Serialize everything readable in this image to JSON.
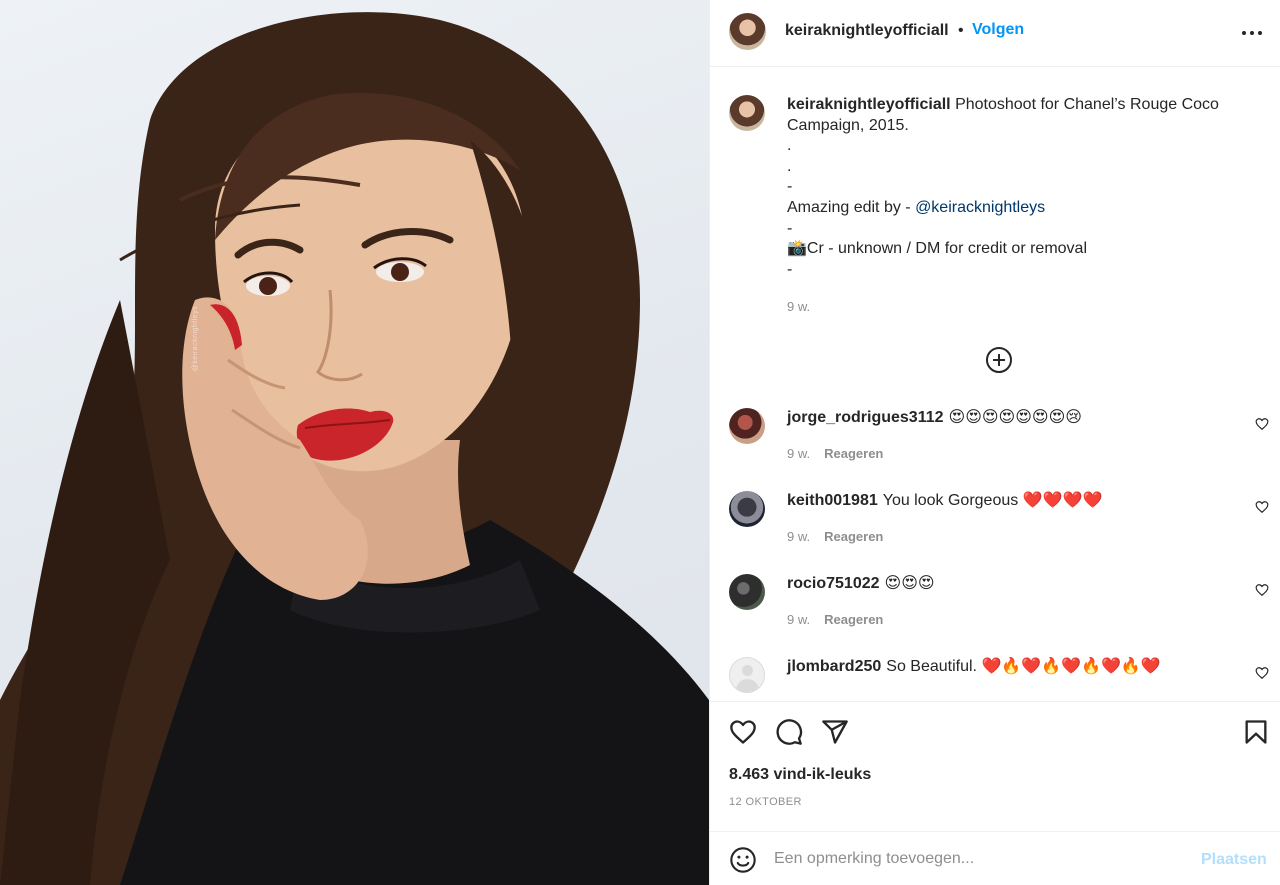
{
  "post": {
    "author": "keiraknightleyofficiall",
    "follow_label": "Volgen",
    "separator": "•",
    "photo_watermark": "@keiracknightleys"
  },
  "caption": {
    "username": "keiraknightleyofficiall",
    "line1": "Photoshoot for Chanel’s Rouge Coco Campaign, 2015.",
    "line2": ".",
    "line3": ".",
    "line4": "-",
    "line5_prefix": "Amazing edit by - ",
    "line5_mention": "@keiracknightleys",
    "line6": "-",
    "line7": "📸Cr - unknown / DM for credit or removal",
    "line8": "-",
    "time": "9 w."
  },
  "comments": [
    {
      "username": "jorge_rodrigues3112",
      "text": "😍😍😍😍😍😍😍😢",
      "time": "9 w.",
      "reply_label": "Reageren"
    },
    {
      "username": "keith001981",
      "text": "You look Gorgeous ❤️❤️❤️❤️",
      "time": "9 w.",
      "reply_label": "Reageren"
    },
    {
      "username": "rocio751022",
      "text": "😍😍😍",
      "time": "9 w.",
      "reply_label": "Reageren"
    },
    {
      "username": "jlombard250",
      "text": "So Beautiful. ❤️🔥❤️🔥❤️🔥❤️🔥❤️",
      "time": "",
      "reply_label": ""
    }
  ],
  "actions": {
    "likes": "8.463 vind-ik-leuks",
    "date": "12 OKTOBER"
  },
  "add_comment": {
    "placeholder": "Een opmerking toevoegen...",
    "post_label": "Plaatsen"
  },
  "colors": {
    "link": "#0095f6",
    "mention": "#00376b",
    "muted": "#8e8e8e",
    "post_disabled": "#b2dffc"
  },
  "icons": [
    "more-options-icon",
    "load-more-comments-icon",
    "heart-icon",
    "comment-icon",
    "share-icon",
    "bookmark-icon",
    "emoji-icon"
  ]
}
